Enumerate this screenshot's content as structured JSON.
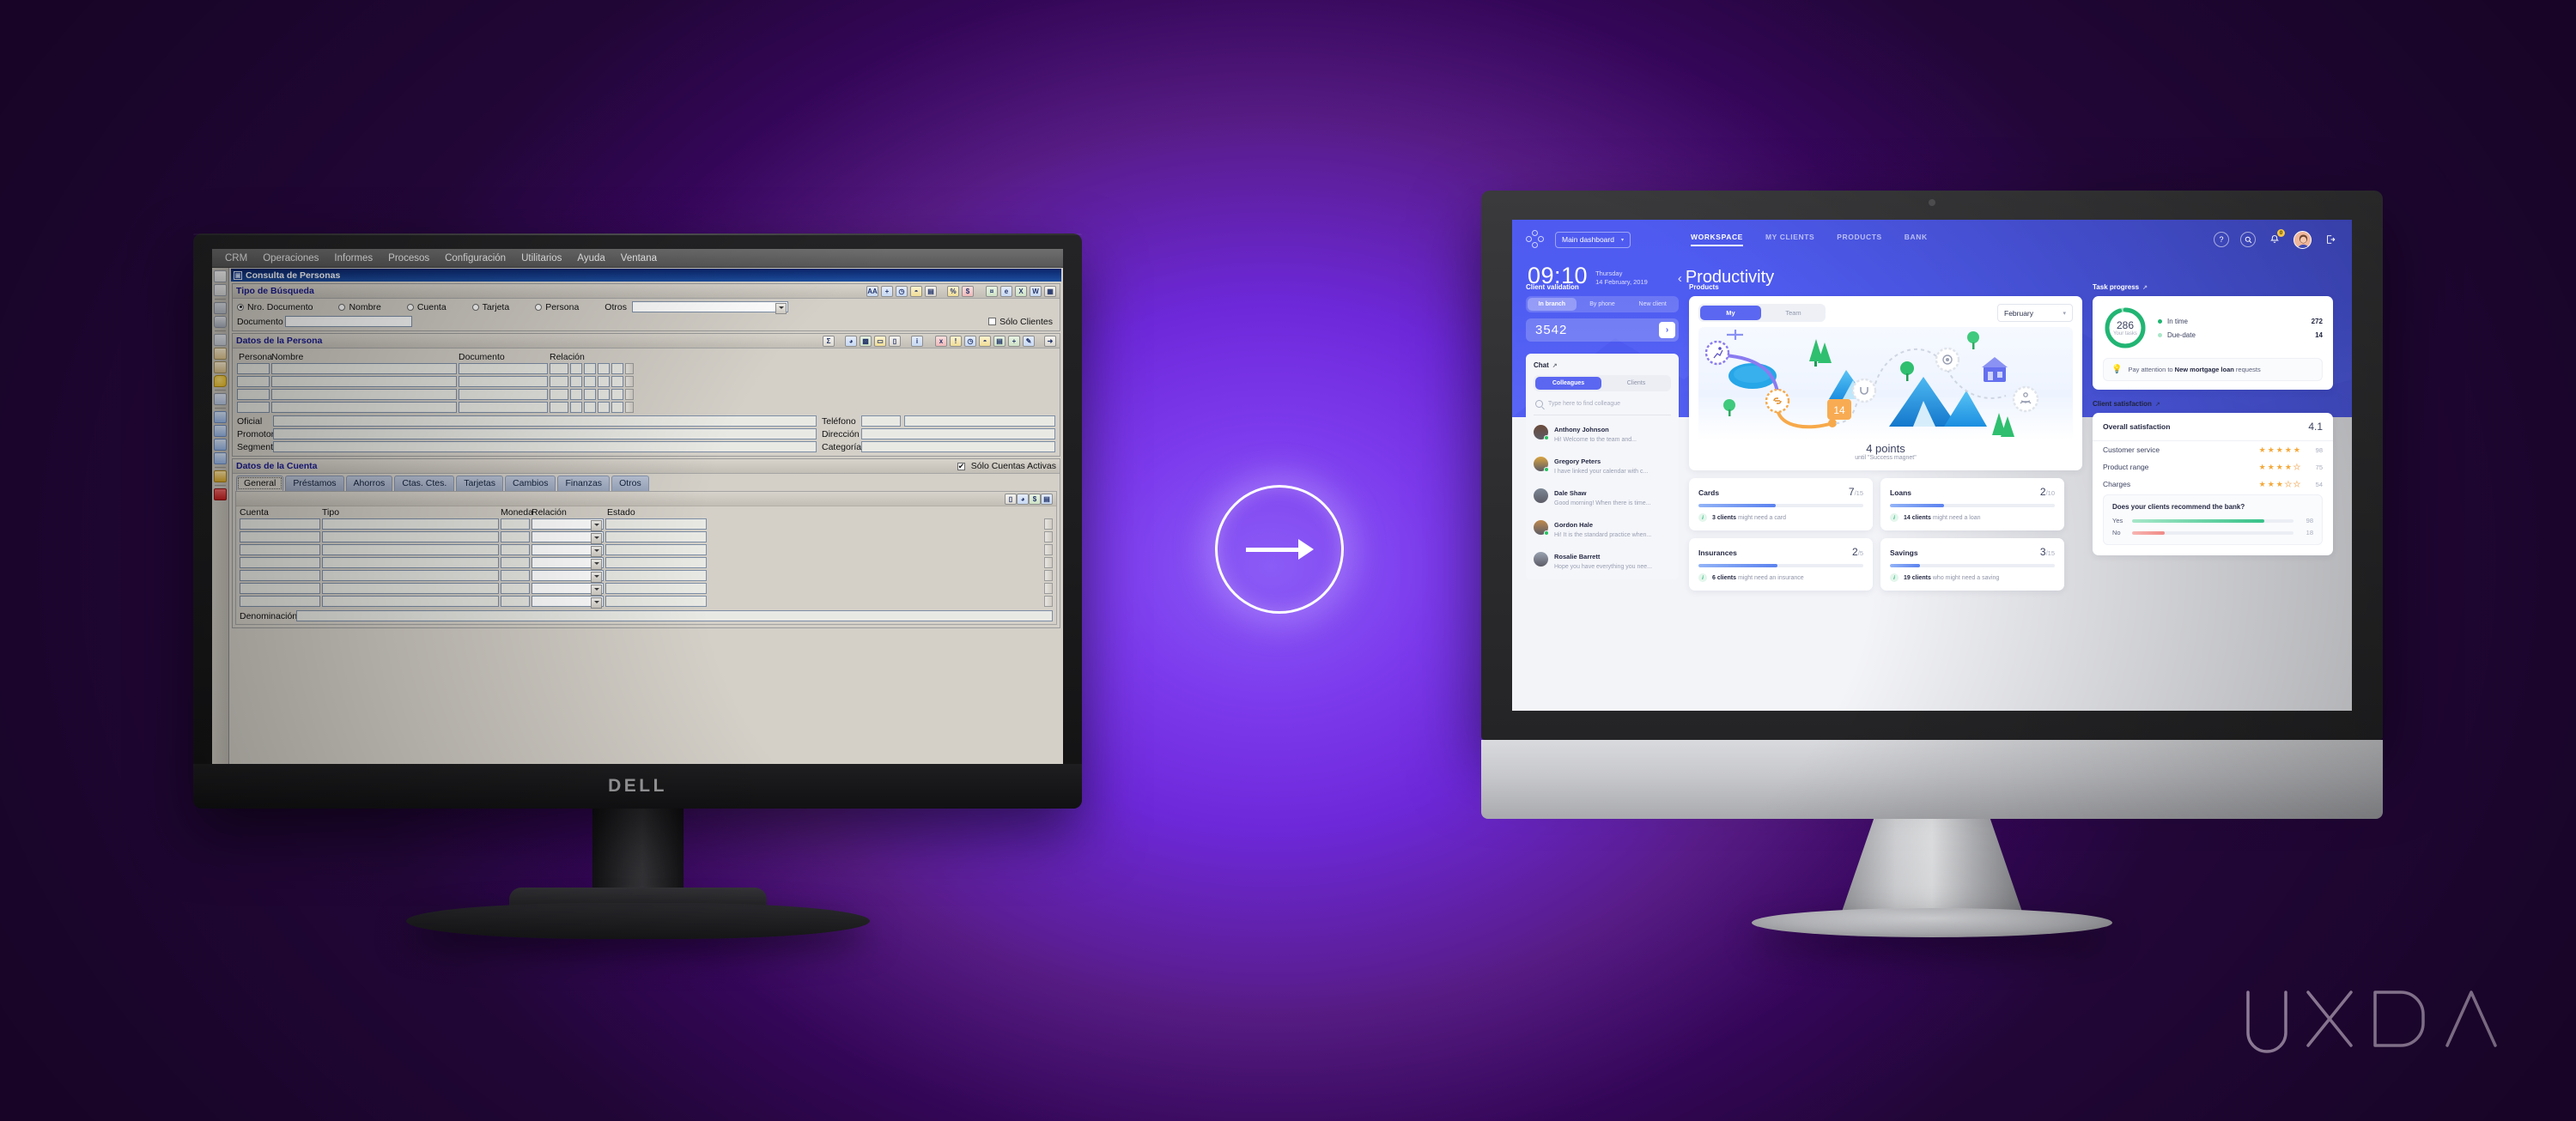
{
  "legacy": {
    "app_name": "CRM",
    "menu": [
      "CRM",
      "Operaciones",
      "Informes",
      "Procesos",
      "Configuración",
      "Utilitarios",
      "Ayuda",
      "Ventana"
    ],
    "window_title": "Consulta de Personas",
    "search_group": {
      "title": "Tipo de Búsqueda",
      "radios": [
        "Nro. Documento",
        "Nombre",
        "Cuenta",
        "Tarjeta",
        "Persona"
      ],
      "selected_radio": "Nro. Documento",
      "otros_label": "Otros",
      "otros_value": "",
      "documento_label": "Documento",
      "documento_value": "",
      "only_clients_label": "Sólo Clientes",
      "only_clients_checked": false
    },
    "person_group": {
      "title": "Datos de la Persona",
      "columns": [
        "Persona",
        "Nombre",
        "Documento",
        "Relación"
      ],
      "rows": 4,
      "fields": [
        {
          "label": "Oficial",
          "value": ""
        },
        {
          "label": "Promotor",
          "value": ""
        },
        {
          "label": "Segmento",
          "value": ""
        },
        {
          "label": "Teléfono",
          "value": ""
        },
        {
          "label": "Dirección",
          "value": ""
        },
        {
          "label": "Categoría",
          "value": ""
        }
      ]
    },
    "account_group": {
      "title": "Datos de la Cuenta",
      "only_active_label": "Sólo Cuentas Activas",
      "only_active_checked": true,
      "tabs": [
        "General",
        "Préstamos",
        "Ahorros",
        "Ctas. Ctes.",
        "Tarjetas",
        "Cambios",
        "Finanzas",
        "Otros"
      ],
      "active_tab": "General",
      "columns": [
        "Cuenta",
        "Tipo",
        "Moneda",
        "Relación",
        "Estado"
      ],
      "rows": 7,
      "footer_label": "Denominación",
      "footer_value": ""
    },
    "monitor_brand": "DELL"
  },
  "dashboard": {
    "nav": {
      "workspace_selector": "Main dashboard",
      "links": [
        {
          "label": "WORKSPACE",
          "active": true
        },
        {
          "label": "MY CLIENTS",
          "active": false
        },
        {
          "label": "PRODUCTS",
          "active": false
        },
        {
          "label": "BANK",
          "active": false
        }
      ],
      "help_icon": "?",
      "search_icon": "search-icon",
      "bell_badge": "0",
      "logout_icon": "logout-icon"
    },
    "hero": {
      "clock": "09:10",
      "weekday": "Thursday",
      "date": "14 February, 2019",
      "page_title": "Productivity",
      "back_chevron": "‹"
    },
    "client_validation": {
      "heading": "Client validation",
      "tabs": [
        "In branch",
        "By phone",
        "New client"
      ],
      "active_tab": "In branch",
      "input_value": "3542",
      "submit_icon": "chevron-right-icon"
    },
    "chat": {
      "heading": "Chat",
      "tabs": [
        "Colleagues",
        "Clients"
      ],
      "active_tab": "Colleagues",
      "search_placeholder": "Type here to find colleague",
      "contacts": [
        {
          "name": "Anthony Johnson",
          "message": "Hi! Welcome to the team and...",
          "online": true,
          "avatar_color": "#6b4a3a"
        },
        {
          "name": "Gregory Peters",
          "message": "I have linked your calendar with c...",
          "online": true,
          "avatar_color": "#d9a441"
        },
        {
          "name": "Dale Shaw",
          "message": "Good morning! When there is time...",
          "online": false,
          "avatar_color": "#7d8796"
        },
        {
          "name": "Gordon Hale",
          "message": "Hi! It is the standard practice when...",
          "online": true,
          "avatar_color": "#c08a4e"
        },
        {
          "name": "Rosalie Barrett",
          "message": "Hope you have everything you nee...",
          "online": false,
          "avatar_color": "#9aa3b2"
        }
      ]
    },
    "products": {
      "heading": "Products",
      "scope_tabs": [
        "My",
        "Team"
      ],
      "active_scope": "My",
      "month": "February",
      "journey": {
        "points_value": "4 points",
        "points_caption": "until \"Success magnet\"",
        "badge_value": "14"
      },
      "stats": [
        {
          "name": "Cards",
          "current": "7",
          "total": "/15",
          "percent": 47,
          "hint_bold": "3 clients",
          "hint_rest": "might need a card"
        },
        {
          "name": "Loans",
          "current": "2",
          "total": "/10",
          "percent": 33,
          "hint_bold": "14 clients",
          "hint_rest": "might need a loan"
        },
        {
          "name": "Insurances",
          "current": "2",
          "total": "/5",
          "percent": 48,
          "hint_bold": "6 clients",
          "hint_rest": "might need an insurance"
        },
        {
          "name": "Savings",
          "current": "3",
          "total": "/15",
          "percent": 18,
          "hint_bold": "19 clients",
          "hint_rest": "who might need a saving"
        }
      ]
    },
    "task_progress": {
      "heading": "Task progress",
      "total": "286",
      "total_label": "Your tasks",
      "legend": [
        {
          "label": "In time",
          "value": "272",
          "color": "#21b573"
        },
        {
          "label": "Due-date",
          "value": "14",
          "color": "#a8e6c8"
        }
      ],
      "tip_prefix": "Pay attention to ",
      "tip_bold": "New mortgage loan",
      "tip_suffix": " requests",
      "tip_icon": "lightbulb-icon"
    },
    "client_satisfaction": {
      "heading": "Client satisfaction",
      "overall_label": "Overall satisfaction",
      "overall_value": "4.1",
      "rows": [
        {
          "label": "Customer service",
          "stars": 5,
          "value": "98"
        },
        {
          "label": "Product range",
          "stars": 4,
          "value": "75"
        },
        {
          "label": "Charges",
          "stars": 3,
          "value": "54"
        }
      ],
      "recommend": {
        "question": "Does your clients recommend the bank?",
        "yes_label": "Yes",
        "yes_value": "98",
        "yes_percent": 82,
        "yes_color": "#37c289",
        "no_label": "No",
        "no_value": "18",
        "no_percent": 20,
        "no_color": "#f08a86"
      }
    }
  },
  "overlay": {
    "arrow_icon": "arrow-right-icon",
    "brand": "UXDA"
  },
  "colors": {
    "accent_purple": "#5b67f1",
    "hero_blue": "#4f5bf0",
    "green": "#21b573",
    "orange_star": "#f4a838",
    "legacy_face": "#d4d0c8",
    "legacy_title": "#1b1b8f"
  }
}
